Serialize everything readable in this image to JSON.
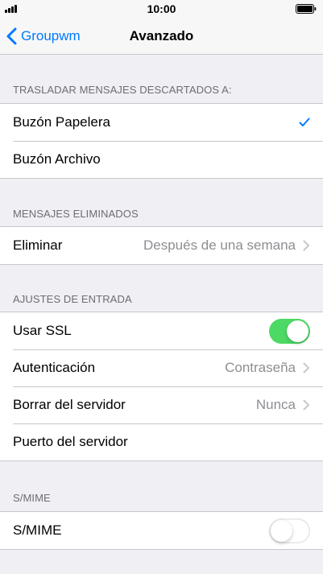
{
  "status_bar": {
    "time": "10:00"
  },
  "nav": {
    "back_label": "Groupwm",
    "title": "Avanzado"
  },
  "sections": {
    "move_discarded": {
      "header": "TRASLADAR MENSAJES DESCARTADOS A:",
      "items": [
        {
          "label": "Buzón Papelera",
          "selected": true
        },
        {
          "label": "Buzón Archivo",
          "selected": false
        }
      ]
    },
    "deleted_messages": {
      "header": "MENSAJES ELIMINADOS",
      "items": [
        {
          "label": "Eliminar",
          "value": "Después de una semana"
        }
      ]
    },
    "incoming_settings": {
      "header": "AJUSTES DE ENTRADA",
      "items": [
        {
          "label": "Usar SSL",
          "toggle": true
        },
        {
          "label": "Autenticación",
          "value": "Contraseña"
        },
        {
          "label": "Borrar del servidor",
          "value": "Nunca"
        },
        {
          "label": "Puerto del servidor"
        }
      ]
    },
    "smime": {
      "header": "S/MIME",
      "items": [
        {
          "label": "S/MIME",
          "toggle": false
        }
      ]
    }
  },
  "colors": {
    "accent": "#007aff",
    "toggle_on": "#4cd964",
    "background": "#efeff4",
    "secondary_text": "#8e8e93",
    "header_text": "#6d6d72"
  },
  "icons": {
    "back": "chevron-left-icon",
    "disclosure": "chevron-right-icon",
    "selected": "checkmark-icon",
    "signal": "signal-icon",
    "battery": "battery-icon"
  }
}
